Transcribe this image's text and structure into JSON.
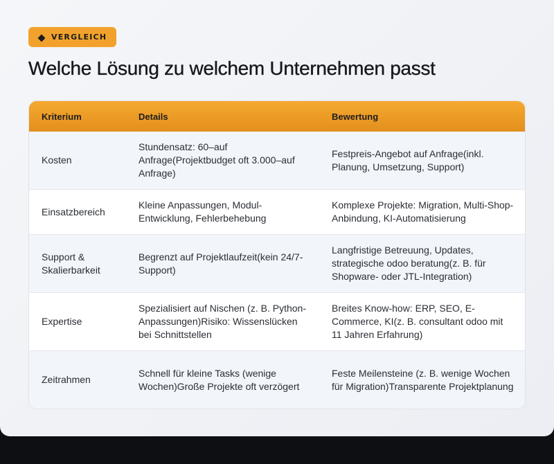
{
  "badge": {
    "icon": "diamond-icon",
    "label": "VERGLEICH",
    "color": "#f2a22c"
  },
  "title": "Welche Lösung zu welchem Unternehmen passt",
  "table": {
    "header_color": "#f0a02a",
    "columns": [
      "Kriterium",
      "Details",
      "Bewertung"
    ],
    "rows": [
      {
        "criterion": "Kosten",
        "details": "Stundensatz: 60–auf Anfrage(Projektbudget oft 3.000–auf Anfrage)",
        "rating": "Festpreis-Angebot auf Anfrage(inkl. Planung, Umsetzung, Support)"
      },
      {
        "criterion": "Einsatzbereich",
        "details": "Kleine Anpassungen, Modul-Entwicklung, Fehlerbehebung",
        "rating": "Komplexe Projekte: Migration, Multi-Shop-Anbindung, KI-Automatisierung"
      },
      {
        "criterion": "Support & Skalierbarkeit",
        "details": "Begrenzt auf Projektlaufzeit(kein 24/7-Support)",
        "rating": "Langfristige Betreuung, Updates, strategische odoo beratung(z. B. für Shopware- oder JTL-Integration)"
      },
      {
        "criterion": "Expertise",
        "details": "Spezialisiert auf Nischen (z. B. Python-Anpassungen)Risiko: Wissenslücken bei Schnittstellen",
        "rating": "Breites Know-how: ERP, SEO, E-Commerce, KI(z. B. consultant odoo mit 11 Jahren Erfahrung)"
      },
      {
        "criterion": "Zeitrahmen",
        "details": "Schnell für kleine Tasks (wenige Wochen)Große Projekte oft verzögert",
        "rating": "Feste Meilensteine (z. B. wenige Wochen für Migration)Transparente Projektplanung"
      }
    ]
  }
}
